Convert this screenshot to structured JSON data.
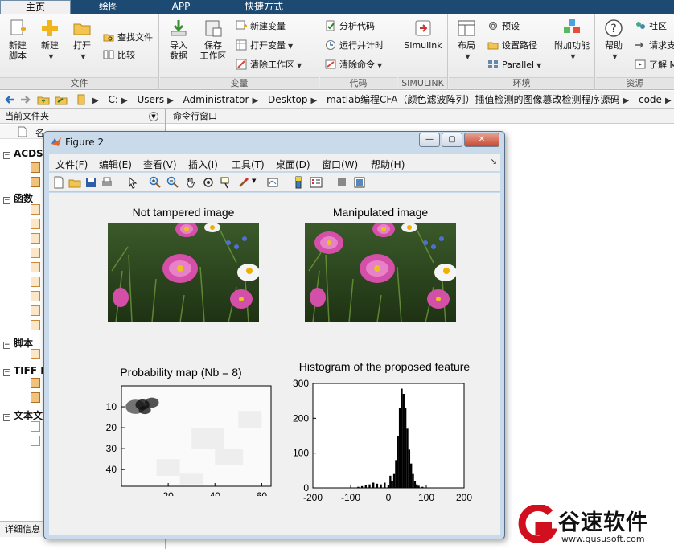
{
  "tabs": [
    {
      "label": "主页",
      "active": true
    },
    {
      "label": "绘图",
      "active": false
    },
    {
      "label": "APP",
      "active": false
    },
    {
      "label": "快捷方式",
      "active": false
    }
  ],
  "ribbon": {
    "file_group": {
      "label": "文件",
      "new_script": "新建\n脚本",
      "new": "新建",
      "open": "打开",
      "find_files": "查找文件",
      "compare": "比较"
    },
    "variable_group": {
      "label": "变量",
      "import_data": "导入\n数据",
      "save_workspace": "保存\n工作区",
      "new_variable": "新建变量",
      "open_variable": "打开变量",
      "clear_workspace": "清除工作区"
    },
    "code_group": {
      "label": "代码",
      "analyze_code": "分析代码",
      "run_time": "运行并计时",
      "clear_commands": "清除命令"
    },
    "simulink_group": {
      "label": "SIMULINK",
      "simulink": "Simulink"
    },
    "env_group": {
      "label": "环境",
      "layout": "布局",
      "preferences": "预设",
      "set_path": "设置路径",
      "parallel": "Parallel",
      "addons": "附加功能"
    },
    "resources_group": {
      "label": "资源",
      "help": "帮助",
      "community": "社区",
      "request_support": "请求支",
      "learn": "了解 M"
    }
  },
  "address": {
    "crumbs": [
      "C:",
      "Users",
      "Administrator",
      "Desktop",
      "matlab编程CFA（颜色滤波阵列）插值检测的图像篡改检测程序源码",
      "code"
    ]
  },
  "left_panel": {
    "header": "当前文件夹",
    "name_col": "名",
    "sections": [
      "ACDS",
      "函数",
      "脚本",
      "TIFF F",
      "文本文"
    ],
    "detail": "详细信息"
  },
  "command_window": {
    "header": "命令行窗口"
  },
  "figure": {
    "title": "Figure 2",
    "menu": [
      "文件(F)",
      "编辑(E)",
      "查看(V)",
      "插入(I)",
      "工具(T)",
      "桌面(D)",
      "窗口(W)",
      "帮助(H)"
    ],
    "win_min": "—",
    "win_max": "▢",
    "win_close": "✕",
    "panel1_title": "Not tampered image",
    "panel2_title": "Manipulated image",
    "panel3_title": "Probability map (Nb = 8)",
    "panel4_title": "Histogram of the proposed feature"
  },
  "chart_data": [
    {
      "type": "heatmap",
      "title": "Probability map (Nb = 8)",
      "xticks": [
        20,
        40,
        60
      ],
      "yticks": [
        10,
        20,
        30,
        40
      ],
      "xlim": [
        0,
        64
      ],
      "ylim": [
        0,
        48
      ],
      "blob": {
        "cx": 9,
        "cy": 10,
        "intensity": 0.9
      }
    },
    {
      "type": "bar",
      "title": "Histogram of the proposed feature",
      "xticks": [
        -200,
        -100,
        0,
        100,
        200
      ],
      "yticks": [
        0,
        100,
        200,
        300
      ],
      "xlim": [
        -200,
        200
      ],
      "ylim": [
        0,
        300
      ],
      "x": [
        -80,
        -70,
        -60,
        -50,
        -40,
        -30,
        -20,
        -10,
        0,
        5,
        10,
        15,
        20,
        25,
        30,
        35,
        40,
        45,
        50,
        55,
        60,
        65,
        70,
        75,
        80,
        90
      ],
      "values": [
        3,
        5,
        8,
        10,
        15,
        12,
        10,
        15,
        8,
        35,
        20,
        40,
        80,
        150,
        230,
        285,
        270,
        230,
        170,
        110,
        70,
        40,
        20,
        10,
        6,
        3
      ]
    }
  ],
  "watermark": {
    "text": "谷速软件",
    "url": "www.gususoft.com"
  },
  "colors": {
    "tabbar": "#1c4a73",
    "figure_frame": "#c9daea",
    "watermark_red": "#d0101e"
  }
}
